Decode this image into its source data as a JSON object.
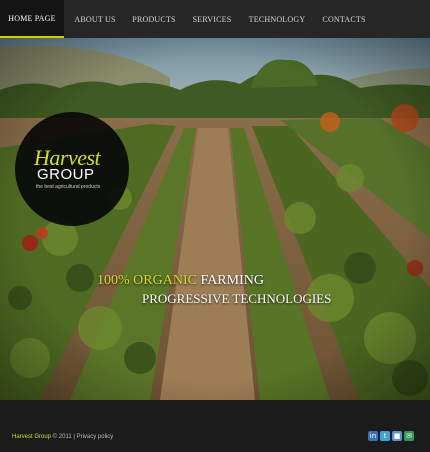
{
  "nav": {
    "items": [
      {
        "label": "HOME PAGE"
      },
      {
        "label": "ABOUT US"
      },
      {
        "label": "PRODUCTS"
      },
      {
        "label": "SERVICES"
      },
      {
        "label": "TECHNOLOGY"
      },
      {
        "label": "CONTACTS"
      }
    ],
    "active_index": 0
  },
  "logo": {
    "word1": "Harvest",
    "word2": "GROUP",
    "tagline": "the best agricultural products"
  },
  "hero": {
    "accent_text": "100% ORGANIC",
    "line1_rest": " FARMING",
    "line2": "PROGRESSIVE TECHNOLOGIES"
  },
  "slider": {
    "prev_icon": "arrow-left-icon",
    "next_icon": "arrow-right-icon",
    "slide_count": 5,
    "active_slide": 1
  },
  "footer": {
    "brand": "Harvest Group",
    "copyright": " © 2011 | Privacy policy",
    "social": [
      {
        "icon": "linkedin-icon",
        "color": "#3b6fb6"
      },
      {
        "icon": "twitter-icon",
        "color": "#3fa3d6"
      },
      {
        "icon": "delicious-icon",
        "color": "#5a8fd0"
      },
      {
        "icon": "chat-icon",
        "color": "#2e9a5a"
      }
    ]
  },
  "colors": {
    "accent": "#d4dd2a",
    "nav_bg": "#262626",
    "footer_bg": "#1b1b1b"
  }
}
